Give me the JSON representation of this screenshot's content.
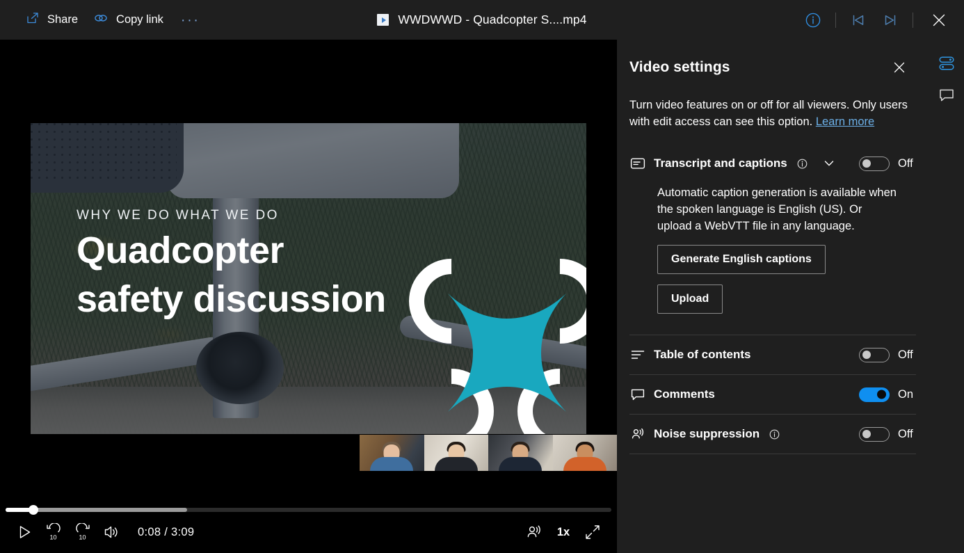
{
  "titlebar": {
    "share_label": "Share",
    "copy_link_label": "Copy link",
    "more_label": "···",
    "file_title": "WWDWWD - Quadcopter S....mp4",
    "icons": {
      "share": "share-icon",
      "copy_link": "link-icon",
      "more": "more-options-icon",
      "info": "info-icon",
      "previous": "previous-track-icon",
      "next": "next-track-icon",
      "close": "close-icon"
    }
  },
  "video": {
    "kicker": "WHY WE DO WHAT WE DO",
    "title_line1": "Quadcopter",
    "title_line2": "safety discussion",
    "logo_color": "#19a8bf",
    "participants": [
      "participant-1",
      "participant-2",
      "participant-3",
      "participant-4"
    ]
  },
  "player": {
    "current_time": "0:08",
    "separator": "/",
    "total_time": "3:09",
    "speed": "1x",
    "progress_percent": 4.6,
    "buffered_percent": 30,
    "play_label": "play-button",
    "rewind_label": "10",
    "forward_label": "10",
    "icons": {
      "play": "play-icon",
      "rewind10": "rewind-10-icon",
      "forward10": "forward-10-icon",
      "volume": "volume-icon",
      "noise_suppression": "noise-suppression-icon",
      "speed": "playback-speed-icon",
      "fullscreen": "fullscreen-icon"
    }
  },
  "panel": {
    "title": "Video settings",
    "description_text": "Turn video features on or off for all viewers. Only users with edit access can see this option. ",
    "learn_more": "Learn more",
    "transcript": {
      "label": "Transcript and captions",
      "state": "Off",
      "toggle_on": false,
      "help_text": "Automatic caption generation is available when the spoken language is English (US). Or upload a WebVTT file in any language.",
      "generate_button": "Generate English captions",
      "upload_button": "Upload"
    },
    "toc": {
      "label": "Table of contents",
      "state": "Off",
      "toggle_on": false
    },
    "comments": {
      "label": "Comments",
      "state": "On",
      "toggle_on": true
    },
    "noise": {
      "label": "Noise suppression",
      "state": "Off",
      "toggle_on": false
    },
    "accent_color": "#0f8ff0",
    "close_label": "close-panel"
  },
  "rail": {
    "settings_label": "video-settings-tab",
    "comments_label": "comments-tab"
  }
}
